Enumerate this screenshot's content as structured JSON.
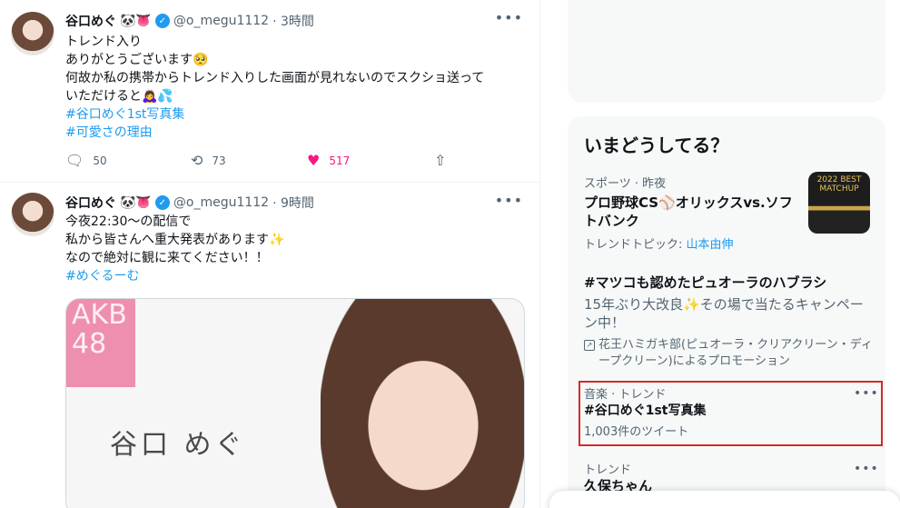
{
  "tweets": [
    {
      "name": "谷口めぐ",
      "emoji": "🐼👅",
      "handle": "@o_megu1112",
      "time": "· 3時間",
      "lines": [
        "トレンド入り",
        "ありがとうございます🥺",
        "何故か私の携帯からトレンド入りした画面が見れないのでスクショ送って",
        "いただけると🙇‍♀️💦"
      ],
      "hashtags": [
        "#谷口めぐ1st写真集",
        "#可愛さの理由"
      ],
      "replies": "50",
      "retweets": "73",
      "likes": "517"
    },
    {
      "name": "谷口めぐ",
      "emoji": "🐼👅",
      "handle": "@o_megu1112",
      "time": "· 9時間",
      "lines": [
        "今夜22:30〜の配信で",
        "私から皆さんへ重大発表があります✨",
        "なので絶対に観に来てください！！"
      ],
      "hashtags": [
        "#めぐるーむ"
      ],
      "media": {
        "logo": "AKB 48",
        "member_name": "谷口 めぐ"
      }
    }
  ],
  "icons": {
    "more": "more-icon",
    "verified": "verified-badge-icon",
    "reply": "reply-icon",
    "retweet": "retweet-icon",
    "like": "heart-icon",
    "share": "share-icon"
  },
  "trends": {
    "title": "いまどうしてる？",
    "items": [
      {
        "context": "スポーツ · 昨夜",
        "title": "プロ野球CS⚾オリックスvs.ソフトバンク",
        "topic_prefix": "トレンドトピック:",
        "topic_link": "山本由伸",
        "thumb_text": "2022 BEST MATCHUP"
      },
      {
        "title": "#マツコも認めたピュオーラのハブラシ",
        "desc": "15年ぶり大改良✨その場で当たるキャンペーン中！",
        "promo": "花王ハミガキ部(ピュオーラ・クリアクリーン・ディープクリーン)によるプロモーション"
      },
      {
        "context": "音楽 · トレンド",
        "title": "#谷口めぐ1st写真集",
        "count": "1,003件のツイート"
      },
      {
        "context": "トレンド",
        "title": "久保ちゃん"
      }
    ]
  },
  "colors": {
    "accent": "#1d9bf0",
    "like": "#f91880",
    "highlight": "#d42a2a"
  }
}
